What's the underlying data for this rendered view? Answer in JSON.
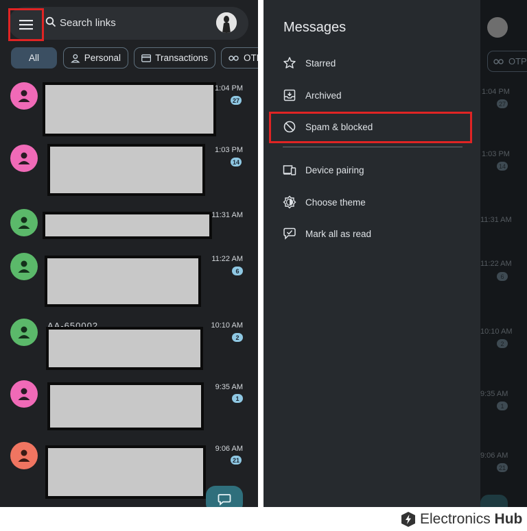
{
  "search": {
    "placeholder": "Search links"
  },
  "chips": [
    {
      "label": "All",
      "icon": null
    },
    {
      "label": "Personal",
      "icon": "person-icon"
    },
    {
      "label": "Transactions",
      "icon": "card-icon"
    },
    {
      "label": "OTP",
      "icon": "key-icon"
    }
  ],
  "conversations": [
    {
      "time": "1:04 PM",
      "badge": "27",
      "avatar_color": "#f06ab7"
    },
    {
      "time": "1:03 PM",
      "badge": "14",
      "avatar_color": "#f06ab7"
    },
    {
      "time": "11:31 AM",
      "badge": "",
      "avatar_color": "#5bb96a"
    },
    {
      "time": "11:22 AM",
      "badge": "6",
      "avatar_color": "#5bb96a"
    },
    {
      "time": "10:10 AM",
      "badge": "2",
      "avatar_color": "#5bb96a"
    },
    {
      "time": "9:35 AM",
      "badge": "1",
      "avatar_color": "#f06ab7"
    },
    {
      "time": "9:06 AM",
      "badge": "21",
      "avatar_color": "#f07561"
    }
  ],
  "partial_sender": "AA-650002",
  "drawer": {
    "title": "Messages",
    "items": [
      {
        "label": "Starred",
        "icon": "star-icon"
      },
      {
        "label": "Archived",
        "icon": "archive-icon"
      },
      {
        "label": "Spam & blocked",
        "icon": "block-icon"
      },
      {
        "label": "Device pairing",
        "icon": "devices-icon"
      },
      {
        "label": "Choose theme",
        "icon": "theme-icon"
      },
      {
        "label": "Mark all as read",
        "icon": "mark-read-icon"
      }
    ]
  },
  "background_list": {
    "chip_label": "OTP",
    "times": [
      "1:04 PM",
      "1:03 PM",
      "11:31 AM",
      "11:22 AM",
      "10:10 AM",
      "9:35 AM",
      "9:06 AM"
    ],
    "badges": [
      "27",
      "14",
      "",
      "6",
      "2",
      "1",
      "21"
    ]
  },
  "brand": {
    "name_light": "Electronics",
    "name_bold": "Hub"
  },
  "colors": {
    "highlight": "#e02424",
    "background": "#1f2124",
    "accent": "#8fc8e3"
  }
}
